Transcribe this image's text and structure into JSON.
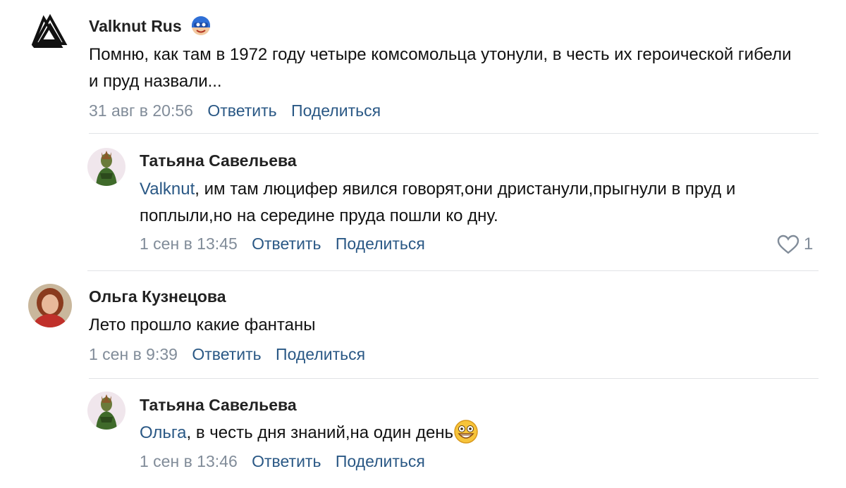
{
  "comments": [
    {
      "author": "Valknut Rus",
      "text": "Помню, как там в 1972 году четыре комсомольца утонули, в честь их героической гибели и пруд назвали...",
      "date": "31 авг в 20:56",
      "reply_label": "Ответить",
      "share_label": "Поделиться"
    },
    {
      "author": "Татьяна Савельева",
      "mention": "Valknut",
      "text": ", им там люцифер явился говорят,они дристанули,прыгнули в пруд и поплыли,но на середине пруда пошли ко дну.",
      "date": "1 сен в 13:45",
      "reply_label": "Ответить",
      "share_label": "Поделиться",
      "likes": "1"
    },
    {
      "author": "Ольга Кузнецова",
      "text": "Лето прошло какие фантаны",
      "date": "1 сен в 9:39",
      "reply_label": "Ответить",
      "share_label": "Поделиться"
    },
    {
      "author": "Татьяна Савельева",
      "mention": "Ольга",
      "text": ", в честь дня знаний,на один день",
      "date": "1 сен в 13:46",
      "reply_label": "Ответить",
      "share_label": "Поделиться"
    }
  ],
  "icons": {
    "author_badge": "mask-emoji-icon",
    "like": "heart-icon",
    "text_emoji": "grinning-face-emoji-icon"
  },
  "colors": {
    "link": "#2a5885",
    "secondary": "#818c99",
    "divider": "#e1e3e6"
  }
}
